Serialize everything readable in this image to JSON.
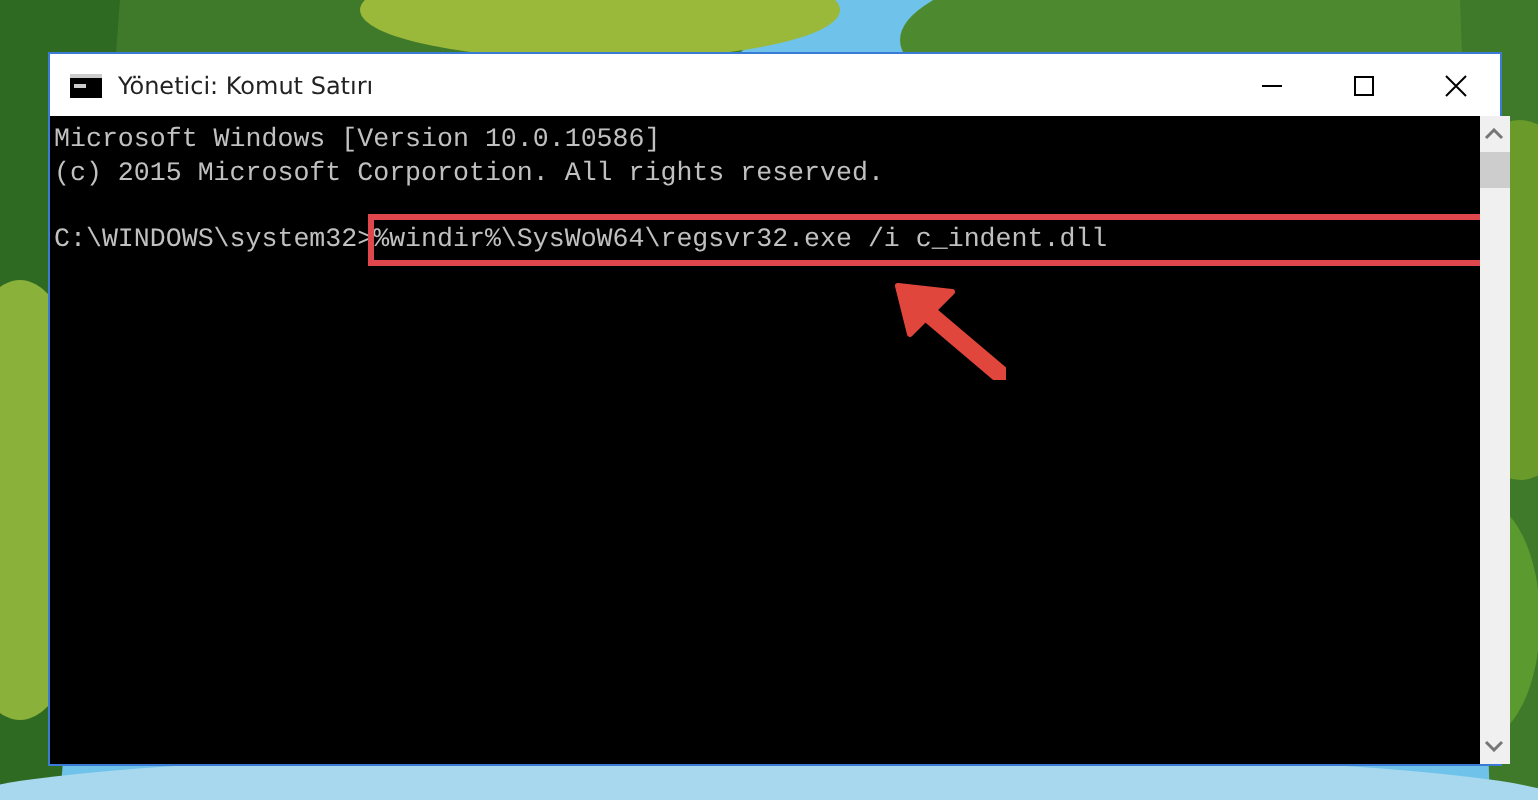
{
  "window": {
    "title": "Yönetici: Komut Satırı"
  },
  "console": {
    "lines": [
      "Microsoft Windows [Version 10.0.10586]",
      "(c) 2015 Microsoft Corporotion. All rights reserved."
    ],
    "prompt": "C:\\WINDOWS\\system32>",
    "command": {
      "text": "%windir%\\SysWoW64\\regsvr32.exe /i c_indent.dll",
      "highlighted": true
    }
  },
  "annotation": {
    "kind": "arrow"
  }
}
